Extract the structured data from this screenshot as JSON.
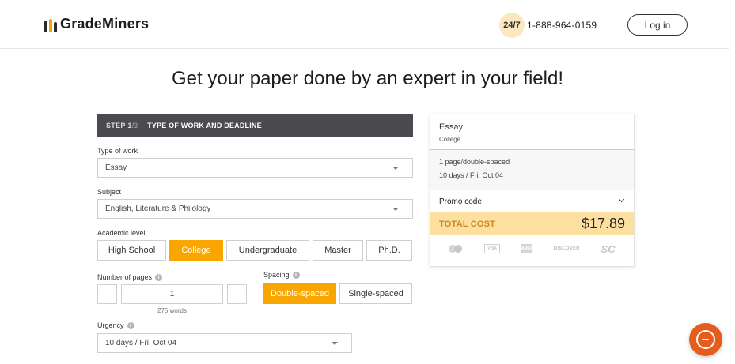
{
  "brand": {
    "name": "GradeMiners"
  },
  "support": {
    "badge": "24/7",
    "phone": "1-888-964-0159"
  },
  "auth": {
    "login_label": "Log in"
  },
  "headline": "Get your paper done by an expert in your field!",
  "step": {
    "label": "STEP 1",
    "of": "/3",
    "title": "TYPE OF WORK AND DEADLINE"
  },
  "form": {
    "type_of_work": {
      "label": "Type of work",
      "value": "Essay"
    },
    "subject": {
      "label": "Subject",
      "value": "English, Literature & Philology"
    },
    "academic_level": {
      "label": "Academic level",
      "options": [
        "High School",
        "College",
        "Undergraduate",
        "Master",
        "Ph.D."
      ],
      "selected": "College"
    },
    "pages": {
      "label": "Number of pages",
      "value": "1",
      "words": "275 words",
      "minus": "−",
      "plus": "+"
    },
    "spacing": {
      "label": "Spacing",
      "options": [
        "Double-spaced",
        "Single-spaced"
      ],
      "selected": "Double-spaced"
    },
    "urgency": {
      "label": "Urgency",
      "value": "10 days / Fri, Oct 04"
    }
  },
  "summary": {
    "type": "Essay",
    "level": "College",
    "spacing": "1 page/double-spaced",
    "deadline": "10 days / Fri, Oct 04",
    "promo_label": "Promo code",
    "total_label": "TOTAL COST",
    "total_amount": "$17.89",
    "payment_methods": [
      "mastercard-icon",
      "visa-icon",
      "amex-icon",
      "discover-icon",
      "sc-icon"
    ],
    "payment_text": {
      "visa": "VISA",
      "amex": "AMEX",
      "discover": "DISCOVER",
      "sc": "SC"
    }
  },
  "colors": {
    "accent": "#f9a600",
    "dark_bar": "#4a4a4f",
    "total_bg": "#fddf9f",
    "chat": "#e65c1d"
  }
}
